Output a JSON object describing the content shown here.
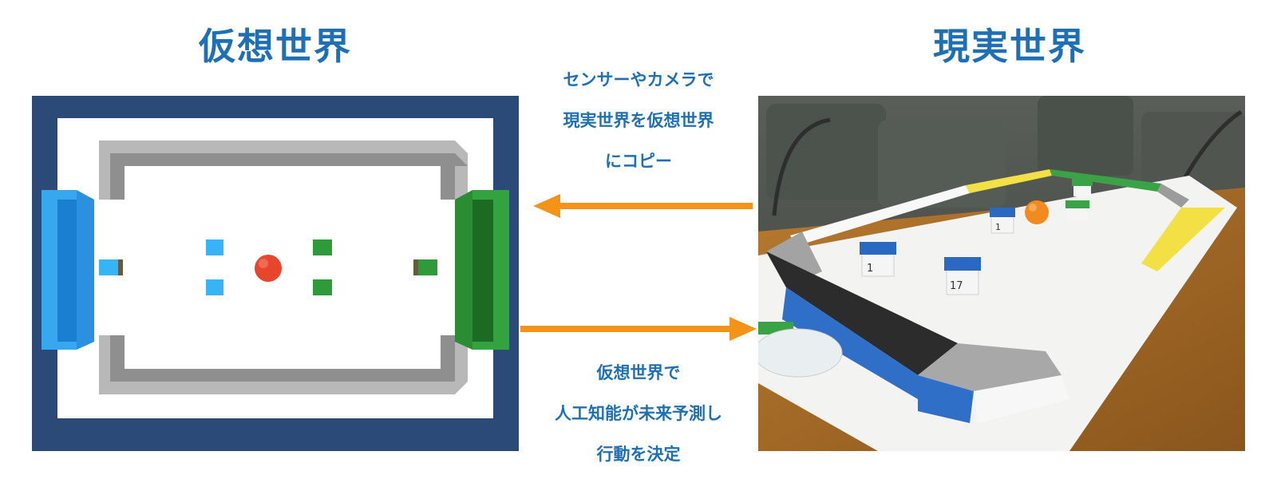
{
  "left_title": "仮想世界",
  "right_title": "現実世界",
  "top_caption": [
    "センサーやカメラで",
    "現実世界を仮想世界",
    "にコピー"
  ],
  "bottom_caption": [
    "仮想世界で",
    "人工知能が未来予測し",
    "行動を決定"
  ],
  "photo_cube_labels": [
    "1",
    "17",
    "1"
  ],
  "colors": {
    "title_blue": "#1f6fb5",
    "arrow_orange": "#f39419",
    "frame_navy": "#2c4a78",
    "team_blue": "#2fa6ef",
    "team_green": "#2f9a3a",
    "ball_red": "#e8452d",
    "ball_orange": "#f38a1f"
  },
  "icons": {
    "arrow_left": "arrow-left-icon",
    "arrow_right": "arrow-right-icon"
  }
}
